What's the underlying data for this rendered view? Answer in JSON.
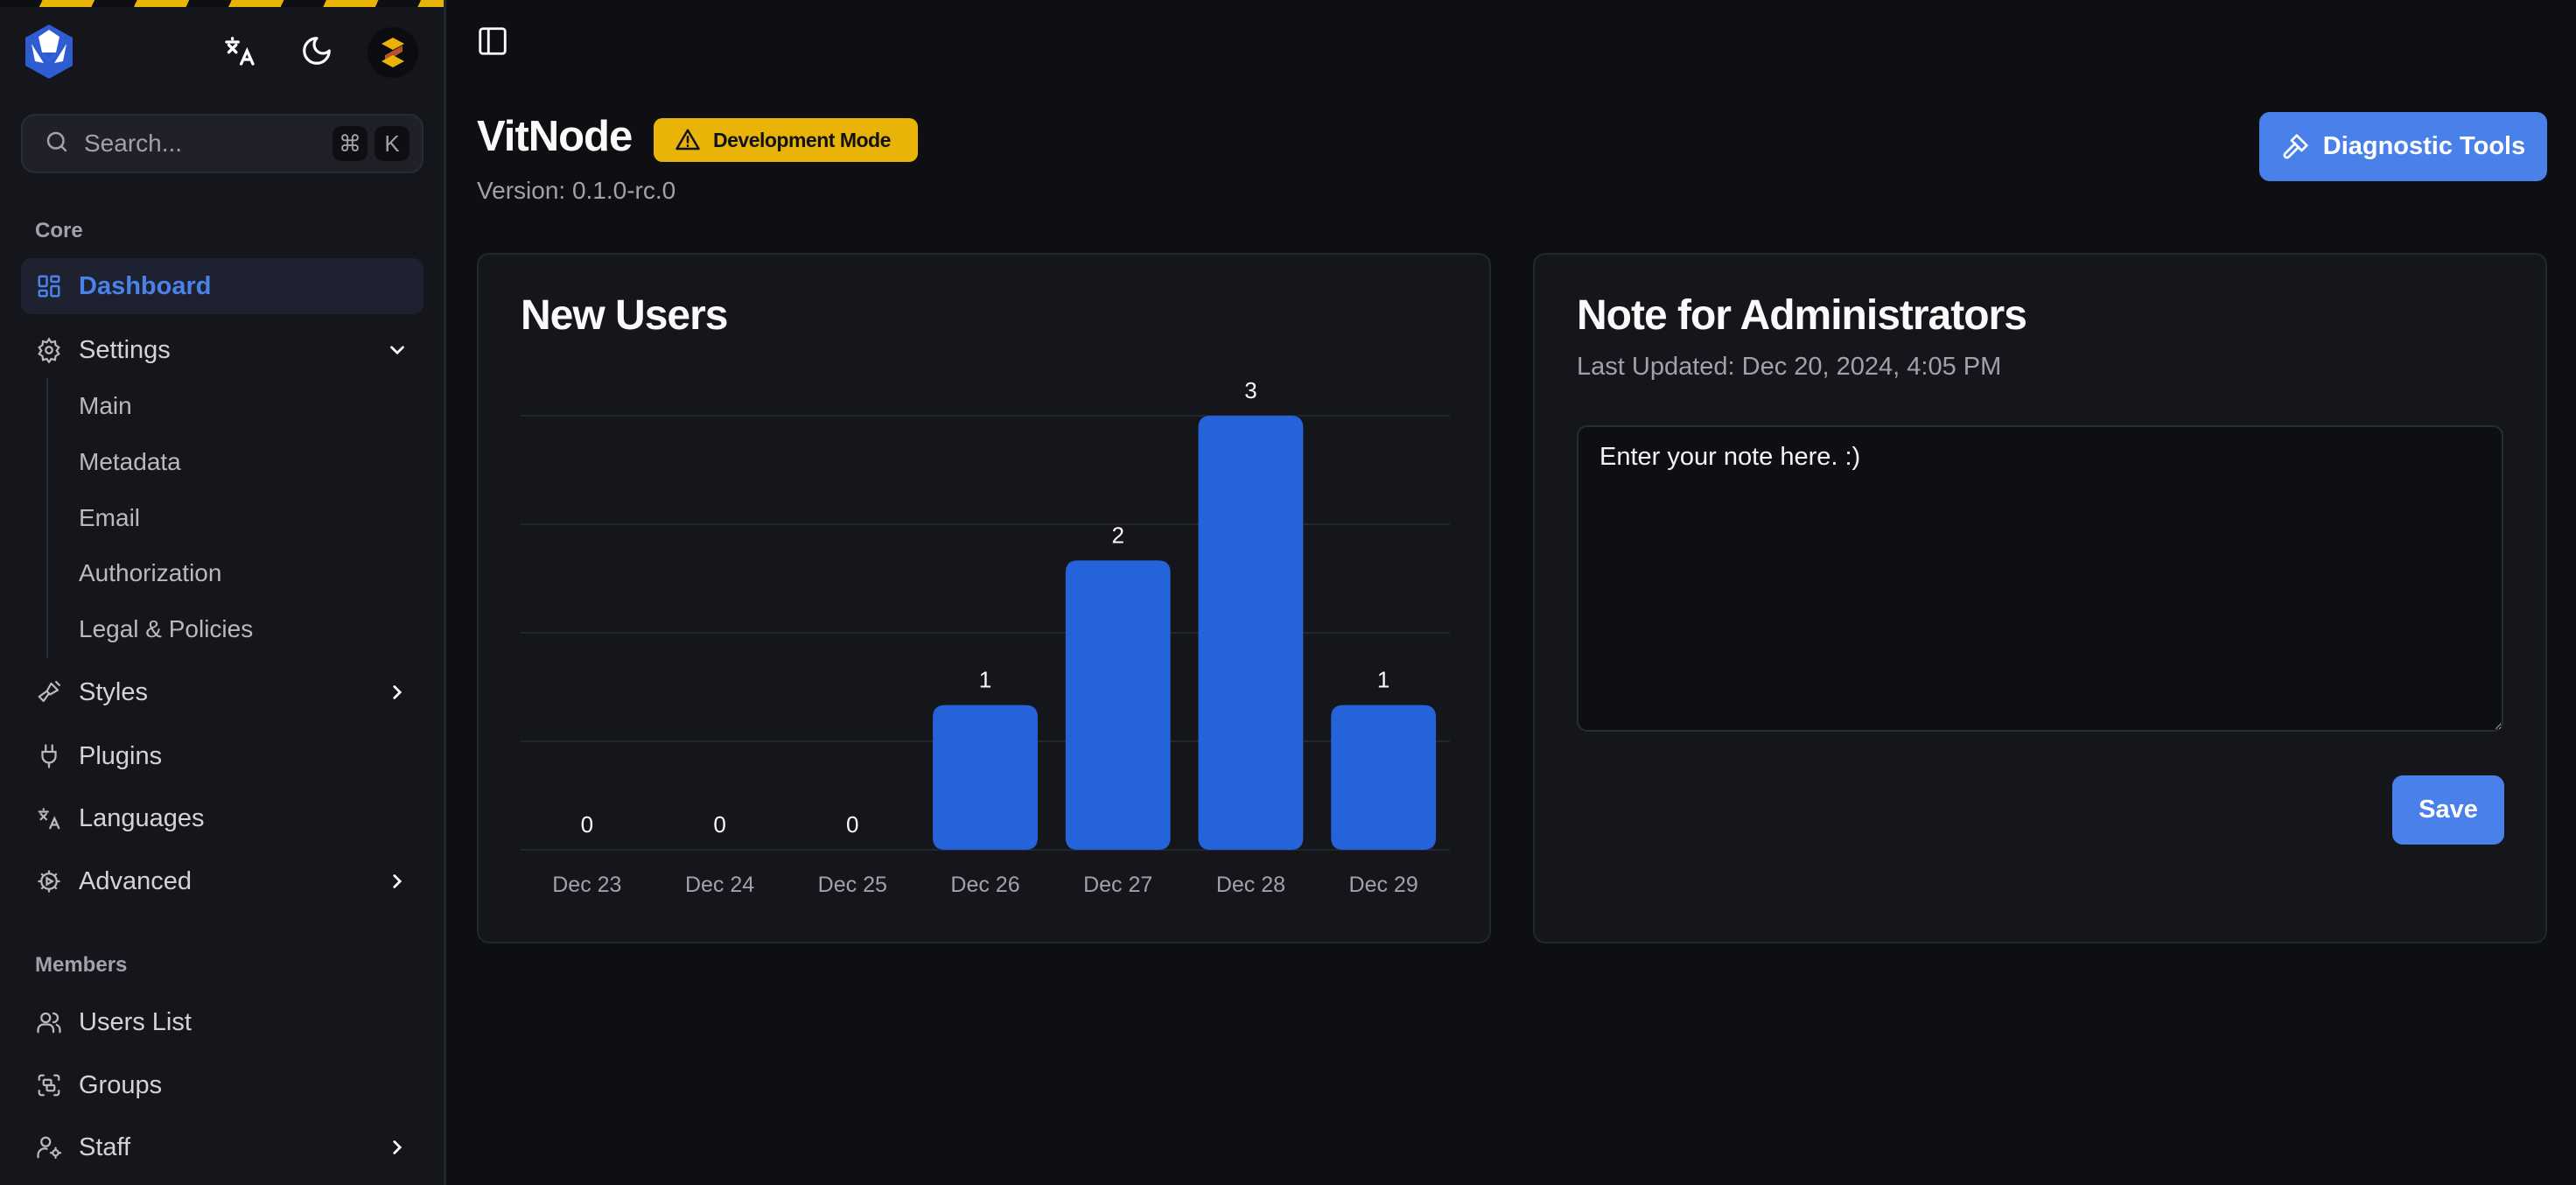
{
  "sidebar": {
    "search": {
      "placeholder": "Search...",
      "shortcut_keys": [
        "⌘",
        "K"
      ]
    },
    "header_icons": [
      "translate-icon",
      "moon-icon",
      "avatar"
    ],
    "sections": [
      {
        "label": "Core",
        "items": [
          {
            "label": "Dashboard",
            "icon": "dashboard-icon",
            "active": true
          },
          {
            "label": "Settings",
            "icon": "gear-icon",
            "expanded": true,
            "children": [
              "Main",
              "Metadata",
              "Email",
              "Authorization",
              "Legal & Policies"
            ]
          },
          {
            "label": "Styles",
            "icon": "paintbrush-icon",
            "has_children": true
          },
          {
            "label": "Plugins",
            "icon": "plug-icon"
          },
          {
            "label": "Languages",
            "icon": "translate-icon"
          },
          {
            "label": "Advanced",
            "icon": "cog-play-icon",
            "has_children": true
          }
        ]
      },
      {
        "label": "Members",
        "items": [
          {
            "label": "Users List",
            "icon": "users-icon"
          },
          {
            "label": "Groups",
            "icon": "group-icon"
          },
          {
            "label": "Staff",
            "icon": "user-cog-icon",
            "has_children": true
          }
        ]
      }
    ]
  },
  "header": {
    "title": "VitNode",
    "badge": "Development Mode",
    "version": "Version: 0.1.0-rc.0",
    "diagnostic_button": "Diagnostic Tools"
  },
  "new_users_card": {
    "title": "New Users"
  },
  "note_card": {
    "title": "Note for Administrators",
    "last_updated": "Last Updated: Dec 20, 2024, 4:05 PM",
    "note_value": "Enter your note here. :)",
    "save_label": "Save"
  },
  "colors": {
    "accent": "#4a80ea",
    "bar": "#2563db",
    "warning": "#eab308"
  },
  "chart_data": {
    "type": "bar",
    "title": "New Users",
    "categories": [
      "Dec 23",
      "Dec 24",
      "Dec 25",
      "Dec 26",
      "Dec 27",
      "Dec 28",
      "Dec 29"
    ],
    "values": [
      0,
      0,
      0,
      1,
      2,
      3,
      1
    ],
    "xlabel": "",
    "ylabel": "",
    "ylim": [
      0,
      3
    ],
    "grid": true,
    "gridlines": 5,
    "data_labels": true,
    "legend": "none"
  }
}
